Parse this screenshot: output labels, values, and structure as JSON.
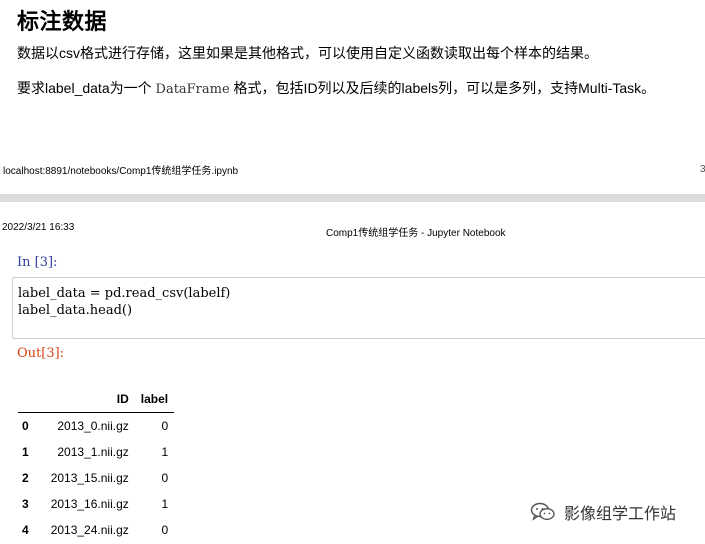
{
  "section": {
    "heading": "标注数据",
    "paragraph_1": "数据以csv格式进行存储，这里如果是其他格式，可以使用自定义函数读取出每个样本的结果。",
    "paragraph_2_before": "要求label_data为一个 ",
    "paragraph_2_code": "DataFrame",
    "paragraph_2_after": " 格式，包括ID列以及后续的labels列，可以是多列，支持Multi-Task。"
  },
  "print_header": {
    "url": "localhost:8891/notebooks/Comp1传统组学任务.ipynb",
    "edge_mark": "3",
    "date": "2022/3/21 16:33",
    "title": "Comp1传统组学任务 - Jupyter Notebook"
  },
  "cell": {
    "in_prompt": "In  [3]:",
    "code_lines": [
      "label_data = pd.read_csv(labelf)",
      "label_data.head()"
    ],
    "out_prompt": "Out[3]:"
  },
  "table": {
    "columns": [
      "",
      "ID",
      "label"
    ],
    "rows": [
      {
        "index": "0",
        "id": "2013_0.nii.gz",
        "label": "0"
      },
      {
        "index": "1",
        "id": "2013_1.nii.gz",
        "label": "1"
      },
      {
        "index": "2",
        "id": "2013_15.nii.gz",
        "label": "0"
      },
      {
        "index": "3",
        "id": "2013_16.nii.gz",
        "label": "1"
      },
      {
        "index": "4",
        "id": "2013_24.nii.gz",
        "label": "0"
      }
    ]
  },
  "watermark": {
    "icon": "wechat-icon",
    "text": "影像组学工作站"
  },
  "colors": {
    "in_prompt": "#303f9f",
    "out_prompt": "#d84315",
    "separator": "#dcdcdc"
  }
}
